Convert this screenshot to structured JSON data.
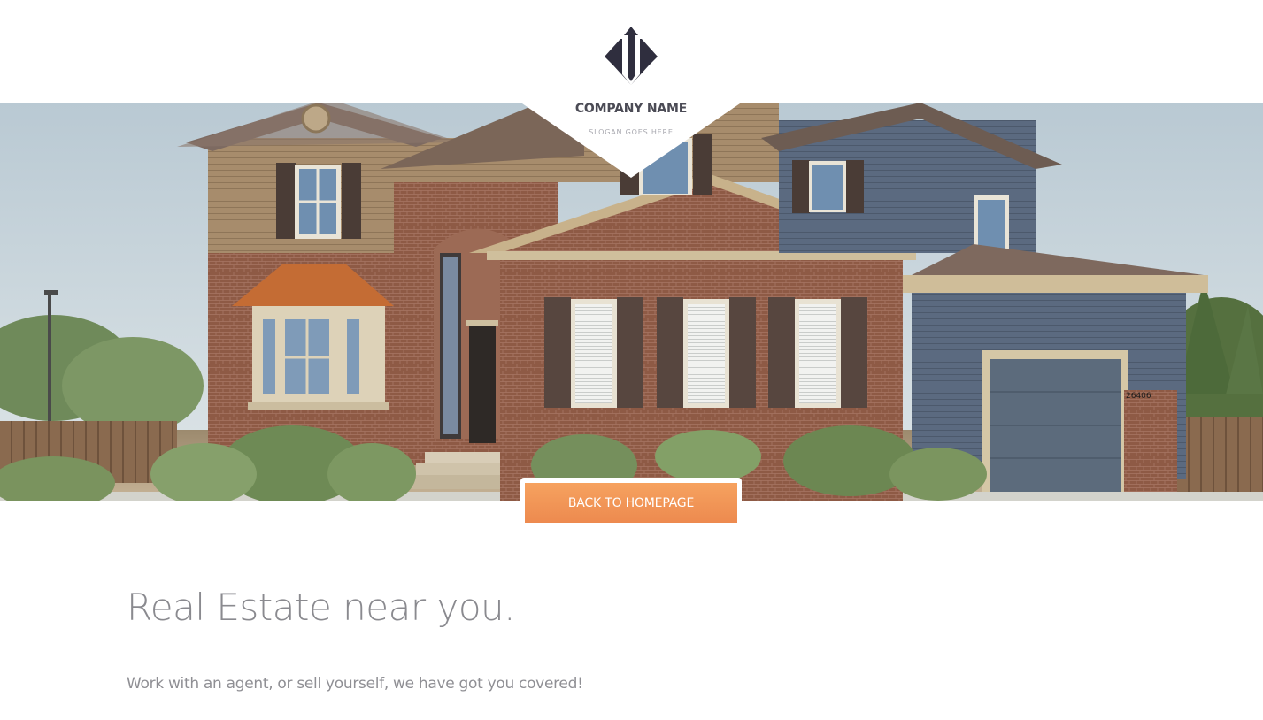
{
  "brand": {
    "logo_icon": "diamond-arrows-logo-icon",
    "company_name": "COMPANY NAME",
    "slogan": "SLOGAN GOES HERE",
    "logo_color": "#2f2e3e"
  },
  "hero": {
    "image": "suburban-house-photo"
  },
  "cta": {
    "label": "BACK TO HOMEPAGE",
    "color": "#f0955a"
  },
  "content": {
    "headline": "Real Estate near you.",
    "subline": "Work with an agent, or sell yourself, we have got you covered!"
  }
}
